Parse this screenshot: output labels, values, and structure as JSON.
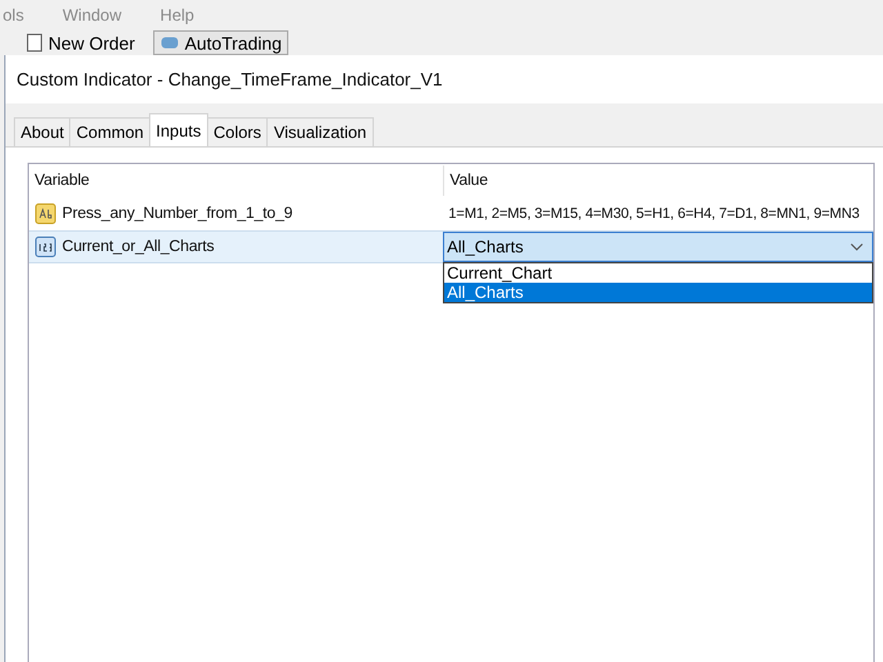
{
  "menu_bar": {
    "items": [
      "ols",
      "Window",
      "Help"
    ]
  },
  "toolbar": {
    "buttons": [
      {
        "label": "New Order",
        "kind": "order"
      },
      {
        "label": "AutoTrading",
        "kind": "auto"
      }
    ]
  },
  "dialog": {
    "title": "Custom Indicator - Change_TimeFrame_Indicator_V1",
    "tabs": [
      {
        "label": "About",
        "selected": false
      },
      {
        "label": "Common",
        "selected": false
      },
      {
        "label": "Inputs",
        "selected": true
      },
      {
        "label": "Colors",
        "selected": false
      },
      {
        "label": "Visualization",
        "selected": false
      }
    ],
    "table": {
      "columns": [
        "Variable",
        "Value"
      ],
      "rows": [
        {
          "kind": "text",
          "variable": "Press_any_Number_from_1_to_9",
          "value": "1=M1, 2=M5, 3=M15, 4=M30, 5=H1, 6=H4, 7=D1, 8=MN1, 9=MN3",
          "selected": false
        },
        {
          "kind": "number",
          "variable": "Current_or_All_Charts",
          "value": "All_Charts",
          "selected": true,
          "expanded": true,
          "options": [
            {
              "label": "Current_Chart",
              "selected": false
            },
            {
              "label": "All_Charts",
              "selected": true
            }
          ]
        }
      ]
    }
  }
}
